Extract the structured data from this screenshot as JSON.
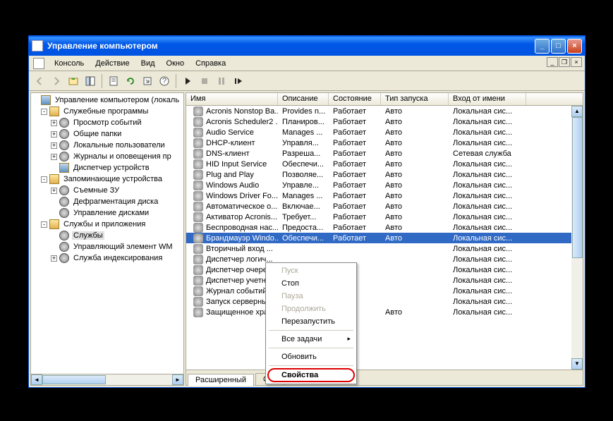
{
  "window": {
    "title": "Управление компьютером",
    "min": "_",
    "max": "□",
    "close": "×"
  },
  "mdi": {
    "min": "_",
    "restore": "❐",
    "close": "×"
  },
  "menu": {
    "console": "Консоль",
    "action": "Действие",
    "view": "Вид",
    "window": "Окно",
    "help": "Справка"
  },
  "tree": {
    "root": "Управление компьютером (локаль",
    "g1": "Служебные программы",
    "g1a": "Просмотр событий",
    "g1b": "Общие папки",
    "g1c": "Локальные пользователи",
    "g1d": "Журналы и оповещения пр",
    "g1e": "Диспетчер устройств",
    "g2": "Запоминающие устройства",
    "g2a": "Съемные ЗУ",
    "g2b": "Дефрагментация диска",
    "g2c": "Управление дисками",
    "g3": "Службы и приложения",
    "g3a": "Службы",
    "g3b": "Управляющий элемент WM",
    "g3c": "Служба индексирования"
  },
  "columns": {
    "name": "Имя",
    "desc": "Описание",
    "state": "Состояние",
    "startup": "Тип запуска",
    "logon": "Вход от имени"
  },
  "colw": {
    "name": 130,
    "desc": 72,
    "state": 74,
    "startup": 96,
    "logon": 110
  },
  "services": [
    {
      "n": "Acronis Nonstop Ba...",
      "d": "Provides n...",
      "s": "Работает",
      "t": "Авто",
      "l": "Локальная сис..."
    },
    {
      "n": "Acronis Scheduler2 ...",
      "d": "Планиров...",
      "s": "Работает",
      "t": "Авто",
      "l": "Локальная сис..."
    },
    {
      "n": "Audio Service",
      "d": "Manages ...",
      "s": "Работает",
      "t": "Авто",
      "l": "Локальная сис..."
    },
    {
      "n": "DHCP-клиент",
      "d": "Управля...",
      "s": "Работает",
      "t": "Авто",
      "l": "Локальная сис..."
    },
    {
      "n": "DNS-клиент",
      "d": "Разреша...",
      "s": "Работает",
      "t": "Авто",
      "l": "Сетевая служба"
    },
    {
      "n": "HID Input Service",
      "d": "Обеспечи...",
      "s": "Работает",
      "t": "Авто",
      "l": "Локальная сис..."
    },
    {
      "n": "Plug and Play",
      "d": "Позволяе...",
      "s": "Работает",
      "t": "Авто",
      "l": "Локальная сис..."
    },
    {
      "n": "Windows Audio",
      "d": "Управле...",
      "s": "Работает",
      "t": "Авто",
      "l": "Локальная сис..."
    },
    {
      "n": "Windows Driver Fo...",
      "d": "Manages ...",
      "s": "Работает",
      "t": "Авто",
      "l": "Локальная сис..."
    },
    {
      "n": "Автоматическое о...",
      "d": "Включае...",
      "s": "Работает",
      "t": "Авто",
      "l": "Локальная сис..."
    },
    {
      "n": "Активатор Acronis...",
      "d": "Требует...",
      "s": "Работает",
      "t": "Авто",
      "l": "Локальная сис..."
    },
    {
      "n": "Беспроводная нас...",
      "d": "Предоста...",
      "s": "Работает",
      "t": "Авто",
      "l": "Локальная сис..."
    },
    {
      "n": "Брандмауэр Windo...",
      "d": "Обеспечи...",
      "s": "Работает",
      "t": "Авто",
      "l": "Локальная сис...",
      "sel": true
    },
    {
      "n": "Вторичный вход ...",
      "d": "",
      "s": "",
      "t": "",
      "l": "Локальная сис..."
    },
    {
      "n": "Диспетчер логич...",
      "d": "",
      "s": "",
      "t": "",
      "l": "Локальная сис..."
    },
    {
      "n": "Диспетчер очере...",
      "d": "",
      "s": "",
      "t": "",
      "l": "Локальная сис..."
    },
    {
      "n": "Диспетчер учетн...",
      "d": "",
      "s": "",
      "t": "",
      "l": "Локальная сис..."
    },
    {
      "n": "Журнал событий ...",
      "d": "",
      "s": "",
      "t": "",
      "l": "Локальная сис..."
    },
    {
      "n": "Запуск серверны...",
      "d": "",
      "s": "",
      "t": "",
      "l": "Локальная сис..."
    },
    {
      "n": "Защищенное хра...",
      "d": "",
      "s": "",
      "t": "Авто",
      "l": "Локальная сис..."
    }
  ],
  "tabs": {
    "ext": "Расширенный",
    "std": "Ста"
  },
  "ctx": {
    "start": "Пуск",
    "stop": "Стоп",
    "pause": "Пауза",
    "resume": "Продолжить",
    "restart": "Перезапустить",
    "alltasks": "Все задачи",
    "refresh": "Обновить",
    "props": "Свойства"
  }
}
